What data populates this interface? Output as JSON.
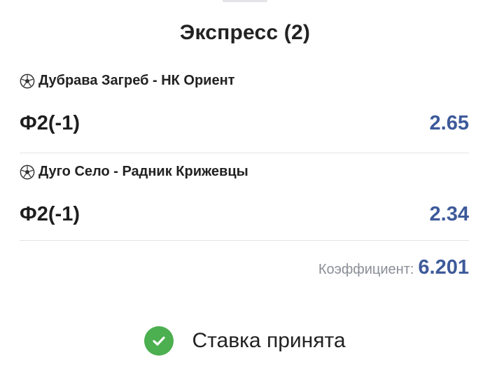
{
  "header": {
    "title": "Экспресс (2)"
  },
  "bets": [
    {
      "sport_icon": "soccer-ball-icon",
      "match": "Дубрава Загреб - НК Ориент",
      "market": "Ф2(-1)",
      "odd": "2.65"
    },
    {
      "sport_icon": "soccer-ball-icon",
      "match": "Дуго Село - Радник Крижевцы",
      "market": "Ф2(-1)",
      "odd": "2.34"
    }
  ],
  "summary": {
    "coefficient_label": "Коэффициент:",
    "coefficient_value": "6.201"
  },
  "status": {
    "icon": "check-circle-icon",
    "text": "Ставка принята"
  },
  "colors": {
    "accent": "#3e5a9b",
    "success": "#4caf50",
    "muted": "#8a8e96",
    "divider": "#e3e4e6"
  }
}
